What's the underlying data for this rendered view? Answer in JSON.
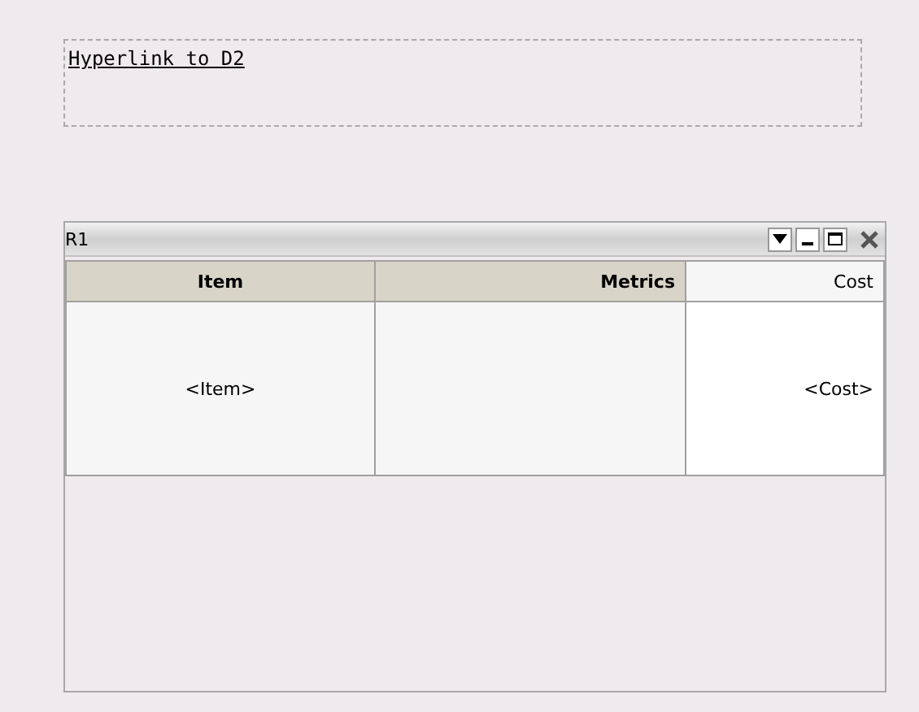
{
  "link_box": {
    "link": "Hyperlink to D2"
  },
  "report": {
    "title": "R1",
    "columns": [
      {
        "label": "Item",
        "shaded": true,
        "kind": "dimension"
      },
      {
        "label": "Metrics",
        "shaded": true,
        "kind": "measure"
      },
      {
        "label": "Cost",
        "shaded": false,
        "kind": "measure"
      }
    ],
    "rows": [
      {
        "cells": [
          "<Item>",
          "",
          "<Cost>"
        ]
      }
    ]
  }
}
